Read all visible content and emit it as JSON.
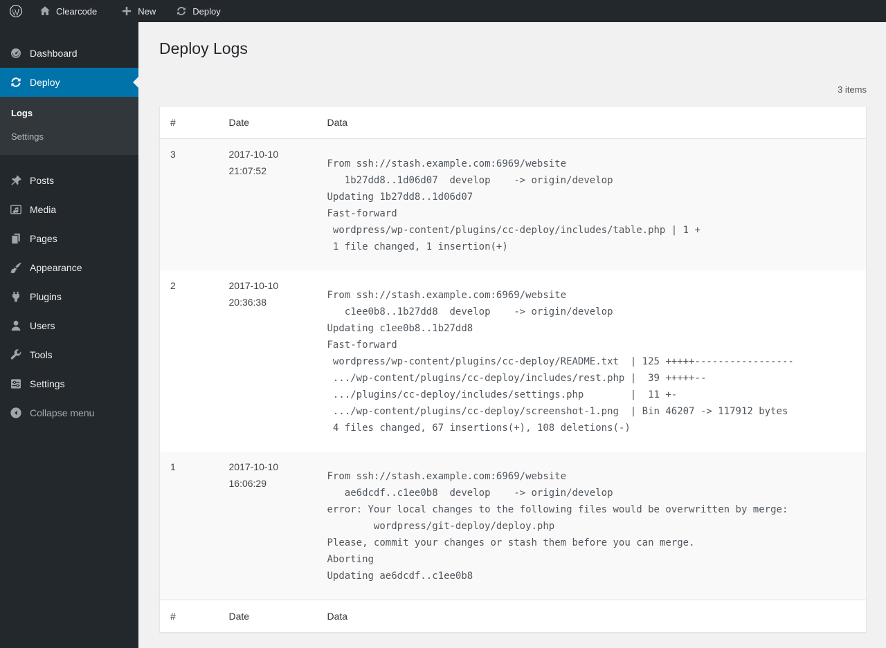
{
  "admin_bar": {
    "site": {
      "label": "Clearcode"
    },
    "new_item": {
      "label": "New"
    },
    "deploy_item": {
      "label": "Deploy"
    }
  },
  "sidebar": {
    "items": [
      {
        "label": "Dashboard",
        "active": false
      },
      {
        "label": "Deploy",
        "active": true
      },
      {
        "label": "Posts",
        "active": false
      },
      {
        "label": "Media",
        "active": false
      },
      {
        "label": "Pages",
        "active": false
      },
      {
        "label": "Appearance",
        "active": false
      },
      {
        "label": "Plugins",
        "active": false
      },
      {
        "label": "Users",
        "active": false
      },
      {
        "label": "Tools",
        "active": false
      },
      {
        "label": "Settings",
        "active": false
      }
    ],
    "deploy_submenu": [
      {
        "label": "Logs",
        "current": true
      },
      {
        "label": "Settings",
        "current": false
      }
    ],
    "collapse_label": "Collapse menu"
  },
  "page": {
    "title": "Deploy Logs",
    "items_count": "3 items",
    "table": {
      "columns": [
        "#",
        "Date",
        "Data"
      ],
      "rows": [
        {
          "num": "3",
          "date": "2017-10-10",
          "time": "21:07:52",
          "log": "From ssh://stash.example.com:6969/website\n   1b27dd8..1d06d07  develop    -> origin/develop\nUpdating 1b27dd8..1d06d07\nFast-forward\n wordpress/wp-content/plugins/cc-deploy/includes/table.php | 1 +\n 1 file changed, 1 insertion(+)"
        },
        {
          "num": "2",
          "date": "2017-10-10",
          "time": "20:36:38",
          "log": "From ssh://stash.example.com:6969/website\n   c1ee0b8..1b27dd8  develop    -> origin/develop\nUpdating c1ee0b8..1b27dd8\nFast-forward\n wordpress/wp-content/plugins/cc-deploy/README.txt  | 125 +++++-----------------\n .../wp-content/plugins/cc-deploy/includes/rest.php |  39 +++++--\n .../plugins/cc-deploy/includes/settings.php        |  11 +-\n .../wp-content/plugins/cc-deploy/screenshot-1.png  | Bin 46207 -> 117912 bytes\n 4 files changed, 67 insertions(+), 108 deletions(-)"
        },
        {
          "num": "1",
          "date": "2017-10-10",
          "time": "16:06:29",
          "log": "From ssh://stash.example.com:6969/website\n   ae6dcdf..c1ee0b8  develop    -> origin/develop\nerror: Your local changes to the following files would be overwritten by merge:\n        wordpress/git-deploy/deploy.php\nPlease, commit your changes or stash them before you can merge.\nAborting\nUpdating ae6dcdf..c1ee0b8"
        }
      ]
    }
  },
  "colors": {
    "admin_bar_bg": "#23282d",
    "menu_bg": "#23282d",
    "submenu_bg": "#32373c",
    "active_item_bg": "#0073aa",
    "content_bg": "#f1f1f1",
    "table_border": "#e5e5e5",
    "row_stripe": "#f9f9f9",
    "log_text": "#50575e"
  }
}
